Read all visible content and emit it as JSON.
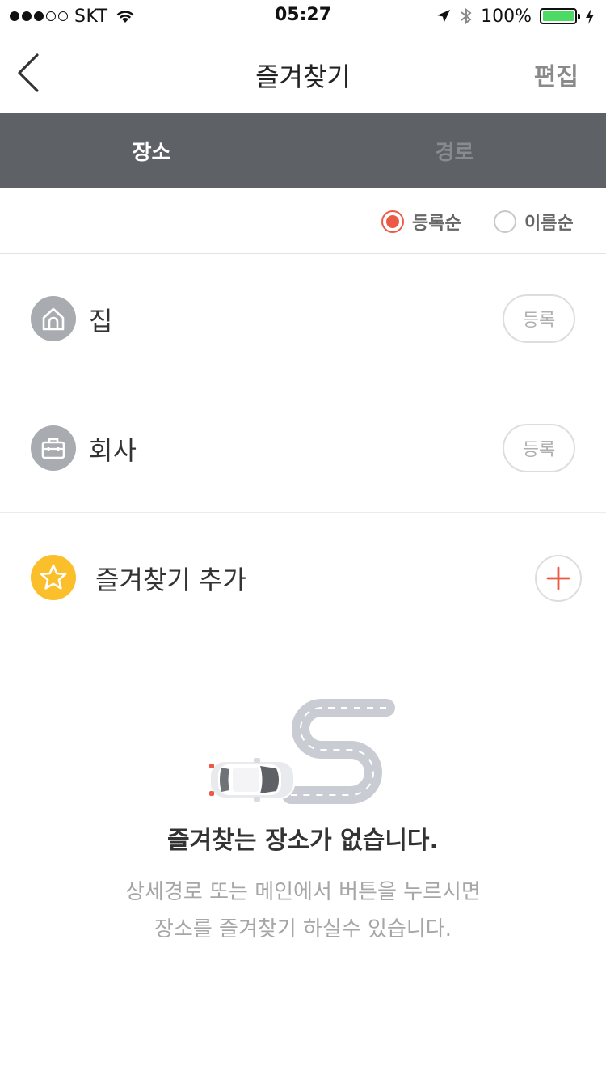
{
  "status_bar": {
    "carrier": "SKT",
    "time": "05:27",
    "battery": "100%",
    "signal_bars_filled": 3,
    "signal_bars_total": 5
  },
  "nav": {
    "title": "즐겨찾기",
    "edit_label": "편집"
  },
  "tabs": [
    {
      "label": "장소",
      "active": true
    },
    {
      "label": "경로",
      "active": false
    }
  ],
  "sort": {
    "options": [
      {
        "label": "등록순",
        "selected": true
      },
      {
        "label": "이름순",
        "selected": false
      }
    ]
  },
  "favorites": [
    {
      "label": "집",
      "icon": "home-icon",
      "button": "등록"
    },
    {
      "label": "회사",
      "icon": "briefcase-icon",
      "button": "등록"
    }
  ],
  "add_favorite": {
    "label": "즐겨찾기 추가",
    "icon": "star-icon"
  },
  "empty_state": {
    "title": "즐겨찾는 장소가 없습니다.",
    "desc_line1": "상세경로 또는 메인에서 버튼을 누르시면",
    "desc_line2": "장소를 즐겨찾기 하실수 있습니다."
  },
  "colors": {
    "accent": "#ec5a45",
    "tab_bar": "#5e6166",
    "star": "#fbbf2c",
    "icon_bg": "#a8abb0",
    "battery": "#4cd964"
  }
}
